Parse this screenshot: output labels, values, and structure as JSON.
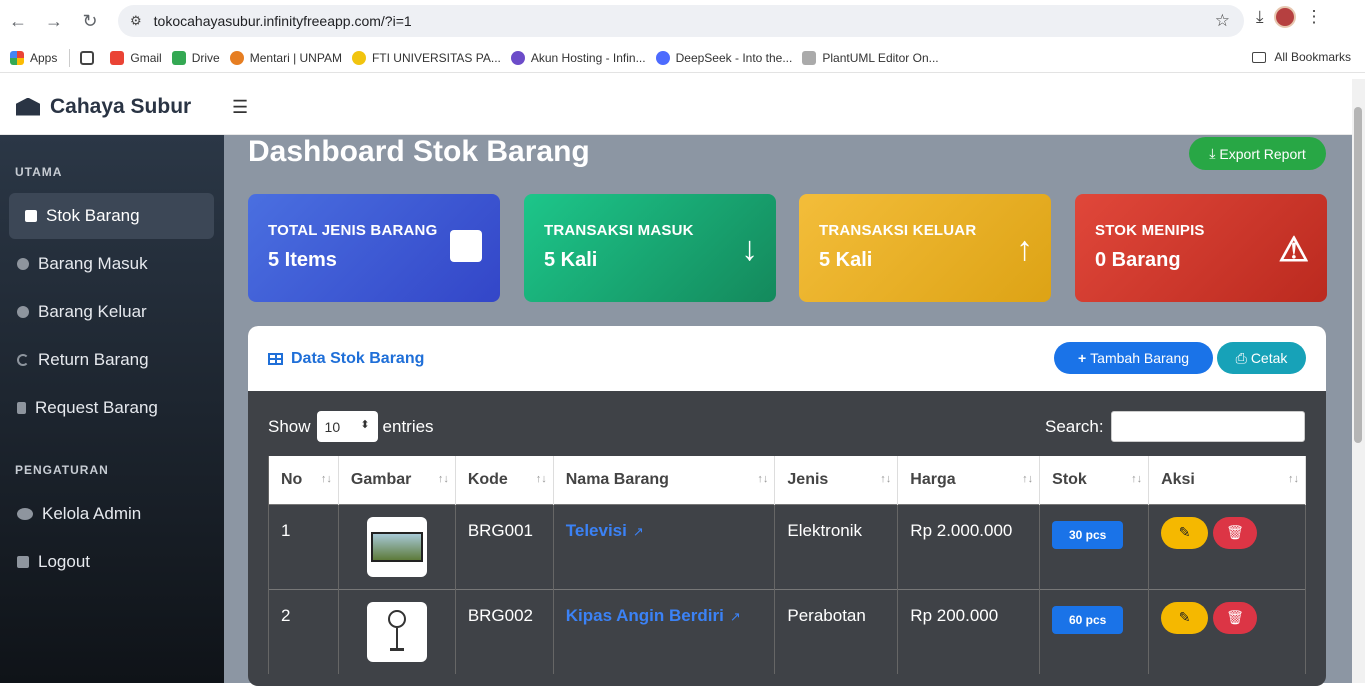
{
  "browser": {
    "url": "tokocahayasubur.infinityfreeapp.com/?i=1",
    "bookmarks": [
      "Apps",
      "Gmail",
      "Drive",
      "Mentari | UNPAM",
      "FTI UNIVERSITAS PA...",
      "Akun Hosting - Infin...",
      "DeepSeek - Into the...",
      "PlantUML Editor On..."
    ],
    "all_bookmarks": "All Bookmarks"
  },
  "app": {
    "brand": "Cahaya Subur"
  },
  "sidebar": {
    "sections": [
      "UTAMA",
      "PENGATURAN"
    ],
    "items": [
      {
        "label": "Stok Barang",
        "active": true
      },
      {
        "label": "Barang Masuk"
      },
      {
        "label": "Barang Keluar"
      },
      {
        "label": "Return Barang"
      },
      {
        "label": "Request Barang"
      },
      {
        "label": "Kelola Admin"
      },
      {
        "label": "Logout"
      }
    ]
  },
  "main": {
    "title": "Dashboard Stok Barang",
    "export_label": "Export Report",
    "cards": [
      {
        "label": "TOTAL JENIS BARANG",
        "value": "5 Items",
        "color": "#3d5bd8"
      },
      {
        "label": "TRANSAKSI MASUK",
        "value": "5 Kali",
        "color": "#1aaa72"
      },
      {
        "label": "TRANSAKSI KELUAR",
        "value": "5 Kali",
        "color": "#f0b429"
      },
      {
        "label": "STOK MENIPIS",
        "value": "0 Barang",
        "color": "#d63b2f"
      }
    ],
    "panel_title": "Data Stok Barang",
    "add_label": "Tambah Barang",
    "print_label": "Cetak",
    "show_label": "Show",
    "entries_value": "10",
    "entries_label": "entries",
    "search_label": "Search:",
    "columns": [
      "No",
      "Gambar",
      "Kode",
      "Nama Barang",
      "Jenis",
      "Harga",
      "Stok",
      "Aksi"
    ],
    "rows": [
      {
        "no": "1",
        "kode": "BRG001",
        "nama": "Televisi",
        "jenis": "Elektronik",
        "harga": "Rp 2.000.000",
        "stok": "30 pcs"
      },
      {
        "no": "2",
        "kode": "BRG002",
        "nama": "Kipas Angin Berdiri",
        "jenis": "Perabotan",
        "harga": "Rp 200.000",
        "stok": "60 pcs"
      }
    ]
  }
}
